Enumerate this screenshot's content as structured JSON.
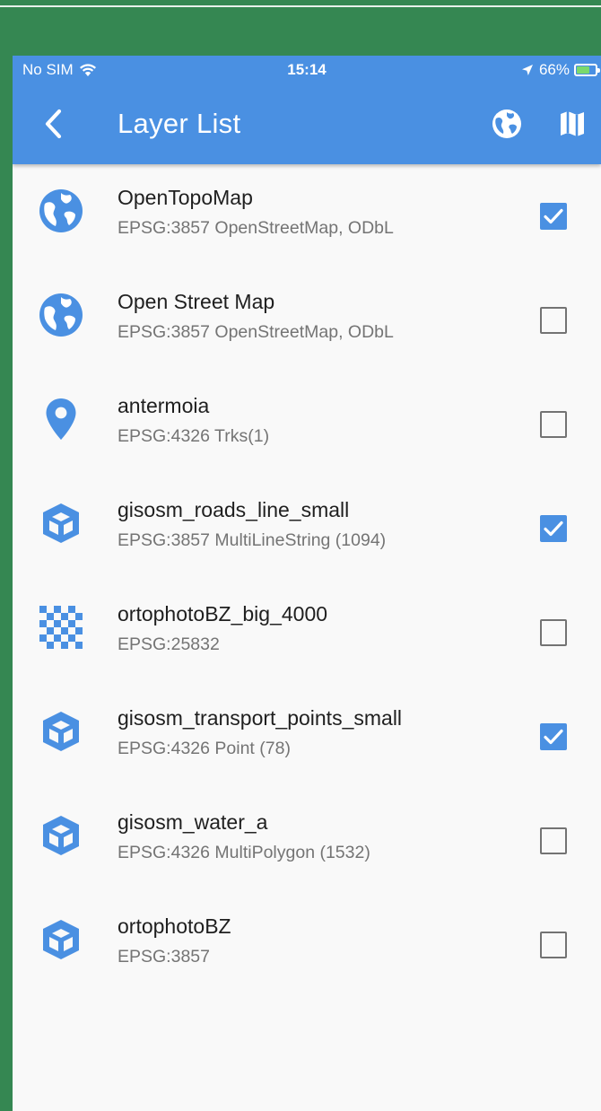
{
  "status_bar": {
    "carrier": "No SIM",
    "time": "15:14",
    "battery": "66%"
  },
  "app_bar": {
    "title": "Layer List",
    "back_icon": "chevron-left-icon",
    "actions": [
      "globe-icon",
      "map-icon"
    ]
  },
  "colors": {
    "accent": "#4a90e2",
    "outer_background": "#358752",
    "list_background": "#f9f9f9"
  },
  "layers": [
    {
      "name": "OpenTopoMap",
      "detail": "EPSG:3857 OpenStreetMap, ODbL",
      "icon": "globe",
      "checked": true
    },
    {
      "name": "Open Street Map",
      "detail": "EPSG:3857 OpenStreetMap, ODbL",
      "icon": "globe",
      "checked": false
    },
    {
      "name": "antermoia",
      "detail": "EPSG:4326 Trks(1)",
      "icon": "map-marker",
      "checked": false
    },
    {
      "name": "gisosm_roads_line_small",
      "detail": "EPSG:3857 MultiLineString (1094)",
      "icon": "vector-cube",
      "checked": true
    },
    {
      "name": "ortophotoBZ_big_4000",
      "detail": "EPSG:25832",
      "icon": "checkerboard",
      "checked": false
    },
    {
      "name": "gisosm_transport_points_small",
      "detail": "EPSG:4326 Point (78)",
      "icon": "vector-cube",
      "checked": true
    },
    {
      "name": "gisosm_water_a",
      "detail": "EPSG:4326 MultiPolygon (1532)",
      "icon": "vector-cube",
      "checked": false
    },
    {
      "name": "ortophotoBZ",
      "detail": "EPSG:3857",
      "icon": "vector-cube",
      "checked": false
    }
  ]
}
